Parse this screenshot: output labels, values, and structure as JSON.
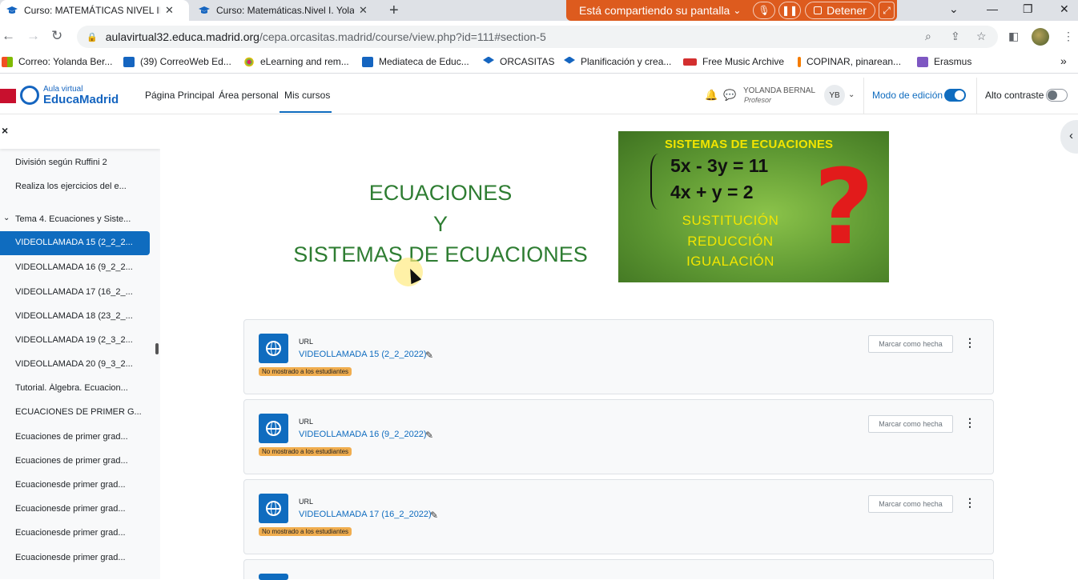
{
  "browser": {
    "tabs": [
      {
        "title": "Curso: MATEMÁTICAS NIVEL II Di",
        "close": "✕"
      },
      {
        "title": "Curso: Matemáticas.Nivel I. Yolan",
        "close": "✕"
      }
    ],
    "new_tab": "+",
    "share_bar": {
      "text": "Está compartiendo su pantalla",
      "chevron": "⌄",
      "stop_label": "Detener"
    },
    "window_controls": [
      "⌄",
      "—",
      "❐",
      "✕"
    ],
    "url_host": "aulavirtual32.educa.madrid.org",
    "url_path": "/cepa.orcasitas.madrid/course/view.php?id=111#section-5",
    "bookmarks": [
      {
        "label": "Correo: Yolanda Ber...",
        "icon": "windows-icon"
      },
      {
        "label": "(39) CorreoWeb Ed...",
        "icon": "mail-icon"
      },
      {
        "label": "eLearning and rem...",
        "icon": "dots-icon"
      },
      {
        "label": "Mediateca de Educ...",
        "icon": "media-icon"
      },
      {
        "label": "ORCASITAS",
        "icon": "moodle-icon"
      },
      {
        "label": "Planificación y crea...",
        "icon": "moodle-icon"
      },
      {
        "label": "Free Music Archive",
        "icon": "fma-icon"
      },
      {
        "label": "COPINAR, pinarean...",
        "icon": "flag-icon"
      },
      {
        "label": "Erasmus",
        "icon": "erasmus-icon"
      }
    ],
    "more_bookmarks": "»"
  },
  "header": {
    "logo_small": "Aula virtual",
    "logo_big": "EducaMadrid",
    "nav": [
      "Página Principal",
      "Área personal",
      "Mis cursos"
    ],
    "user_name": "YOLANDA BERNAL",
    "user_role": "Profesor",
    "avatar": "YB",
    "edit_mode_label": "Modo de edición",
    "high_contrast_label": "Alto contraste"
  },
  "drawer": {
    "close": "×",
    "items": [
      "División según Ruffini 2",
      "Realiza los ejercicios del e...",
      "Tema 4. Ecuaciones y Siste...",
      "VIDEOLLAMADA 15 (2_2_2...",
      "VIDEOLLAMADA 16 (9_2_2...",
      "VIDEOLLAMADA 17 (16_2_...",
      "VIDEOLLAMADA 18 (23_2_...",
      "VIDEOLLAMADA 19 (2_3_2...",
      "VIDEOLLAMADA 20 (9_3_2...",
      "Tutorial. Álgebra. Ecuacion...",
      "ECUACIONES DE PRIMER G...",
      "Ecuaciones de primer grad...",
      "Ecuaciones de primer grad...",
      "Ecuacionesde primer grad...",
      "Ecuacionesde primer grad...",
      "Ecuacionesde primer grad...",
      "Ecuacionesde primer grad..."
    ]
  },
  "banner": {
    "line1": "ECUACIONES",
    "line2": "Y",
    "line3": "SISTEMAS DE ECUACIONES",
    "image": {
      "title": "SISTEMAS DE ECUACIONES",
      "eq1": "5x - 3y = 11",
      "eq2": "4x + y  =  2",
      "method1": "SUSTITUCIÓN",
      "method2": "REDUCCIÓN",
      "method3": "IGUALACIÓN",
      "question": "?"
    }
  },
  "activities": [
    {
      "type": "URL",
      "name": "VIDEOLLAMADA 15 (2_2_2022)",
      "badge": "No mostrado a los estudiantes",
      "mark": "Marcar como hecha"
    },
    {
      "type": "URL",
      "name": "VIDEOLLAMADA 16 (9_2_2022)",
      "badge": "No mostrado a los estudiantes",
      "mark": "Marcar como hecha"
    },
    {
      "type": "URL",
      "name": "VIDEOLLAMADA 17 (16_2_2022)",
      "badge": "No mostrado a los estudiantes",
      "mark": "Marcar como hecha"
    }
  ],
  "colors": {
    "accent": "#0f6cbf",
    "banner_green": "#2e7d32",
    "badge": "#f0ad4e",
    "share_orange": "#dd5b1e"
  }
}
